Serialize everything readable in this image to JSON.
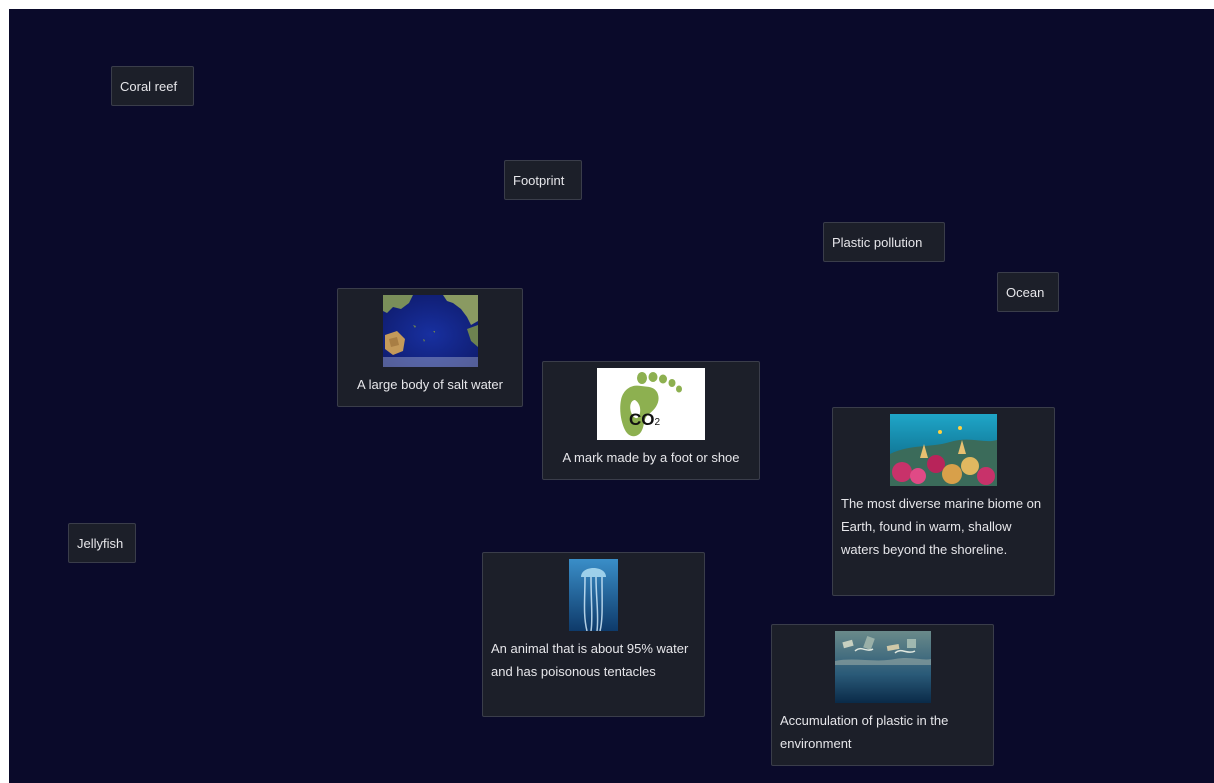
{
  "terms": {
    "coral_reef": "Coral reef",
    "footprint": "Footprint",
    "plastic_pollution": "Plastic pollution",
    "ocean": "Ocean",
    "jellyfish": "Jellyfish"
  },
  "definitions": {
    "ocean": {
      "text": "A large body of salt water",
      "image": "pacific-ocean-map"
    },
    "footprint": {
      "text": "A mark made by a foot or shoe",
      "image": "co2-footprint-logo",
      "image_label": "CO",
      "image_sub": "2"
    },
    "coral_reef": {
      "text": "The most diverse marine biome on Earth, found in warm, shallow waters beyond the shoreline.",
      "image": "coral-reef-photo"
    },
    "jellyfish": {
      "text": "An animal that is about 95% water and has poisonous tentacles",
      "image": "jellyfish-photo"
    },
    "plastic_pollution": {
      "text": "Accumulation of plastic in the environment",
      "image": "plastic-pollution-photo"
    }
  },
  "colors": {
    "background": "#0a0a2a",
    "card": "#1c1f29",
    "border": "#3a3d4a",
    "text": "#e6e6ea",
    "footprint_green": "#8db050"
  }
}
